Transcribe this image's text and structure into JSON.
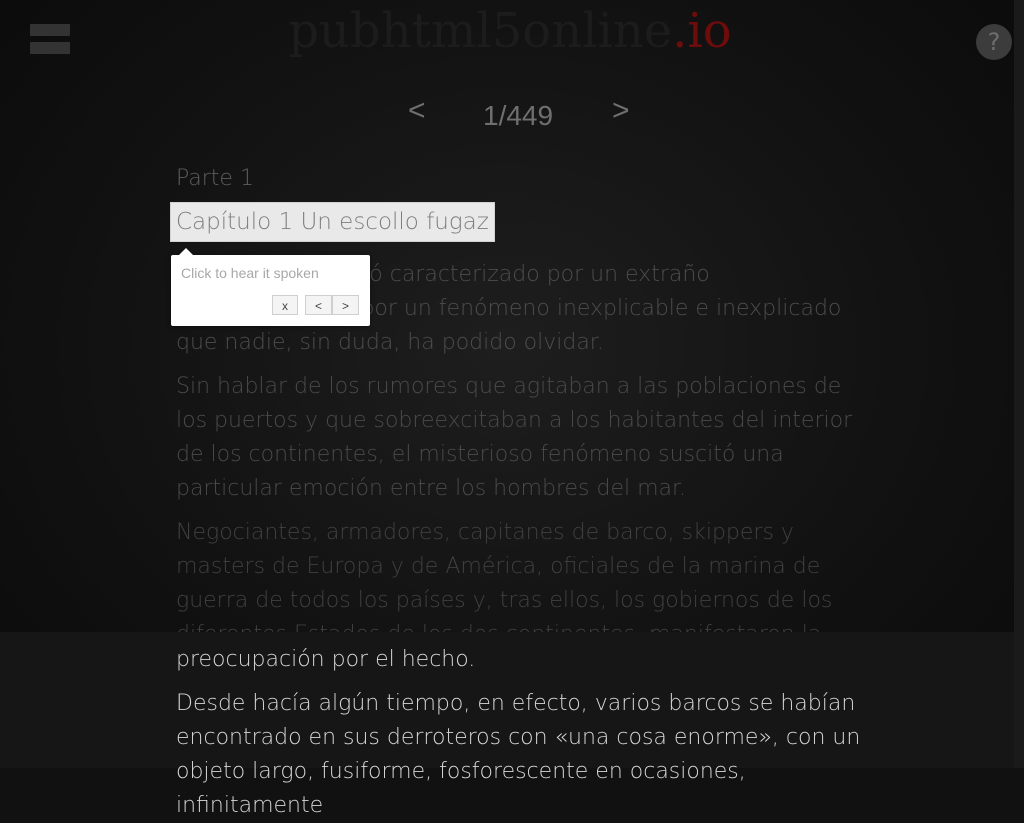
{
  "header": {
    "logo_text": "pubhtml5online",
    "logo_accent": ".io",
    "help_label": "?"
  },
  "pager": {
    "prev": "<",
    "count": "1/449",
    "next": ">"
  },
  "book": {
    "part": "Parte 1",
    "chapter": "Capítulo 1 Un escollo fugaz",
    "paragraphs": [
      "El año 1866 quedó caracterizado por un extraño acontecimiento, por un fenómeno inexplicable e inexplicado que nadie, sin duda, ha podido olvidar.",
      "Sin hablar de los rumores que agitaban a las poblaciones de los puertos y que sobreexcitaban a los habitantes del interior de los continentes, el misterioso fenómeno suscitó una particular emoción entre los hombres del mar.",
      "Negociantes, armadores, capitanes de barco, skippers y masters de Europa y de América, oficiales de la marina de guerra de todos los países y, tras ellos, los gobiernos de los diferentes Estados de los dos continentes, manifestaron la mayor"
    ],
    "bright_line": "preocupación por el hecho.",
    "bright_para": "Desde hacía algún tiempo, en efecto, varios barcos se habían encontrado en sus derroteros con «una cosa enorme», con un objeto largo, fusiforme, fosforescente en ocasiones, infinitamente"
  },
  "tooltip": {
    "text": "Click to hear it spoken",
    "close": "x",
    "prev": "<",
    "next": ">"
  }
}
